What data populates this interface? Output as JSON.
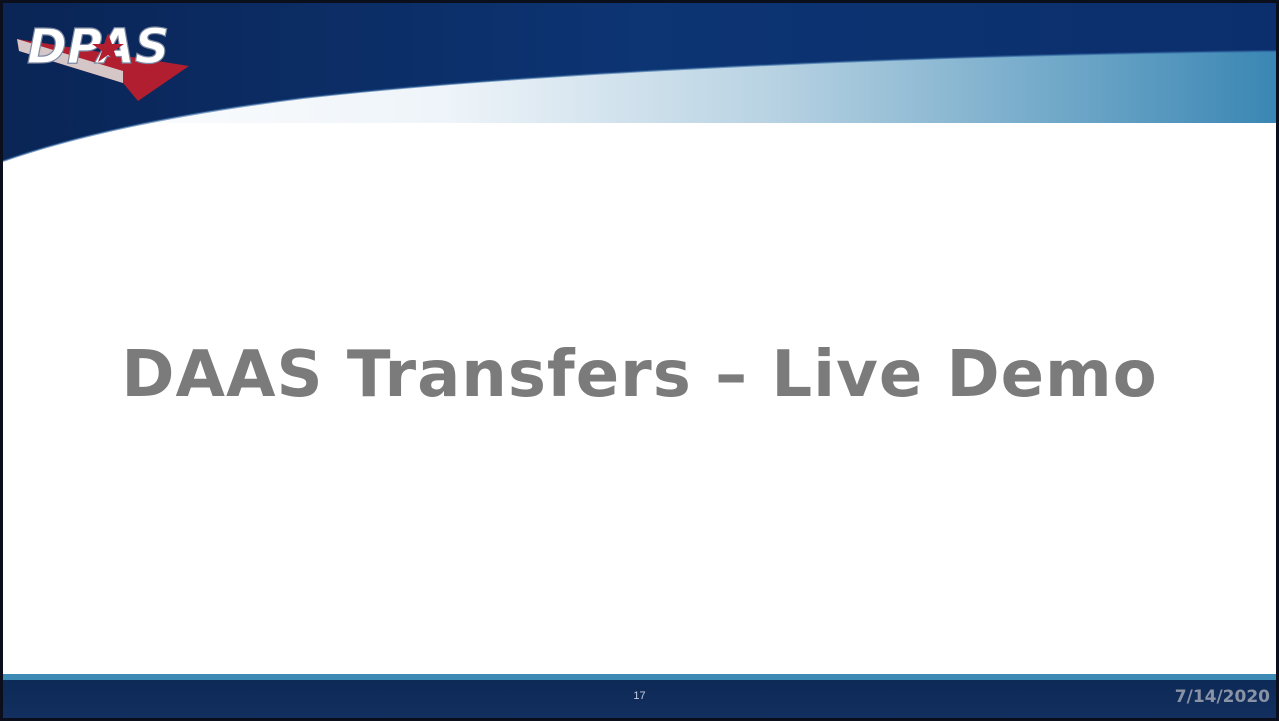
{
  "slide": {
    "title": "DAAS Transfers – Live Demo",
    "page_number": "17",
    "date": "7/14/2020"
  },
  "logo": {
    "text": "DPAS",
    "icon": "dpas-logo-icon"
  },
  "colors": {
    "banner_dark": "#0b2a63",
    "banner_mid": "#1a4f8e",
    "banner_fade": "#3a86b4",
    "title_gray": "#7b7b7b",
    "footer_navy": "#0d2956",
    "footer_accent": "#3d8bb5",
    "logo_red": "#b01e2f"
  }
}
